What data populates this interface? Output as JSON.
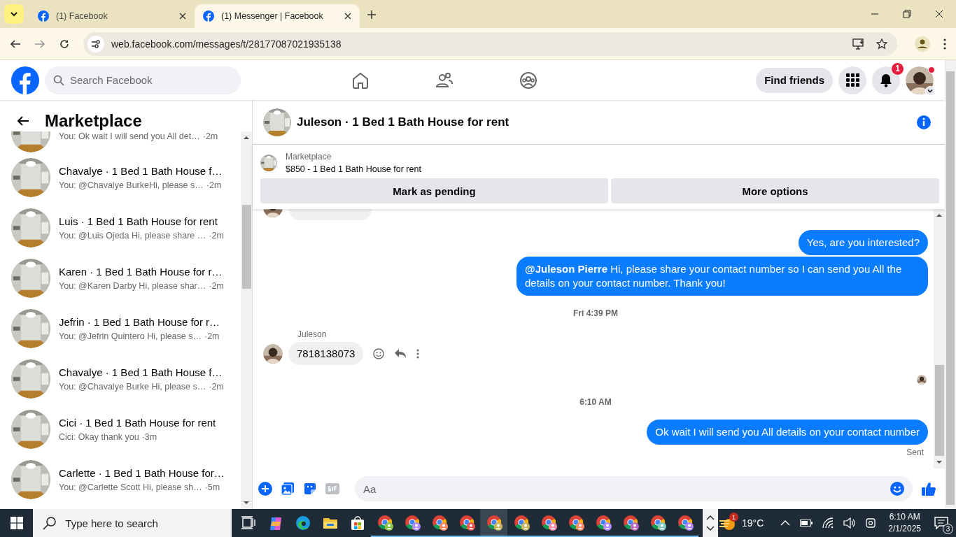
{
  "browser": {
    "tabs": [
      {
        "title": "(1) Facebook",
        "selected": false
      },
      {
        "title": "(1) Messenger | Facebook",
        "selected": true
      }
    ],
    "url": "web.facebook.com/messages/t/28177087021935138"
  },
  "header": {
    "search": {
      "placeholder": "Search Facebook"
    },
    "find_friends": "Find friends",
    "notification_badge": "1"
  },
  "sidebar": {
    "title": "Marketplace",
    "conversations": [
      {
        "preview": "You: Ok wait I will send you All det…",
        "time": "·2m"
      },
      {
        "title": "Chavalye · 1 Bed 1 Bath House f…",
        "preview": "You: @Chavalye BurkeHi, please s…",
        "time": "·2m"
      },
      {
        "title": "Luis · 1 Bed 1 Bath House for rent",
        "preview": "You: @Luis Ojeda Hi, please share …",
        "time": "·2m"
      },
      {
        "title": "Karen · 1 Bed 1 Bath House for r…",
        "preview": "You: @Karen Darby Hi, please shar…",
        "time": "·2m"
      },
      {
        "title": "Jefrin · 1 Bed 1 Bath House for r…",
        "preview": "You: @Jefrin Quintero Hi, please s…",
        "time": "·2m"
      },
      {
        "title": "Chavalye · 1 Bed 1 Bath House f…",
        "preview": "You: @Chavalye Burke Hi, please s…",
        "time": "·2m"
      },
      {
        "title": "Cici · 1 Bed 1 Bath House for rent",
        "preview": "Cici: Okay thank you",
        "time": "·3m"
      },
      {
        "title": "Carlette · 1 Bed 1 Bath House for…",
        "preview": "You: @Carlette Scott Hi, please sh…",
        "time": "·5m"
      }
    ]
  },
  "chat": {
    "title": "Juleson · 1 Bed 1 Bath House for rent",
    "listing": {
      "label": "Marketplace",
      "text": "$850 - 1 Bed 1 Bath House for rent",
      "buttons": [
        "Mark as pending",
        "More options"
      ]
    },
    "messages": [
      {
        "kind": "incoming-cut"
      },
      {
        "kind": "outgoing",
        "text": "Yes, are you interested?"
      },
      {
        "kind": "outgoing",
        "text": "**@Juleson Pierre** Hi, please share your contact number so I can send you All the details on your contact number. Thank you!"
      },
      {
        "kind": "timestamp",
        "text": "Fri 4:39 PM"
      },
      {
        "kind": "incoming",
        "sender": "Juleson",
        "text": "7818138073"
      },
      {
        "kind": "read-receipt"
      },
      {
        "kind": "timestamp",
        "text": "6:10 AM"
      },
      {
        "kind": "outgoing",
        "text": "Ok wait I will send you All details on your contact number",
        "status": "Sent"
      }
    ],
    "composer": {
      "placeholder": "Aa"
    }
  },
  "taskbar": {
    "search": {
      "placeholder": "Type here to search"
    },
    "apps": [
      {
        "kind": "taskview"
      },
      {
        "kind": "copilot"
      },
      {
        "kind": "edge"
      },
      {
        "kind": "explorer"
      },
      {
        "kind": "store"
      },
      {
        "kind": "chrome",
        "color": "#8bc34a",
        "selected": false
      },
      {
        "kind": "chrome",
        "color": "#b388ff",
        "selected": false
      },
      {
        "kind": "chrome",
        "color": "#ff8a65",
        "selected": false
      },
      {
        "kind": "chrome",
        "color": "#ef5350",
        "selected": false
      },
      {
        "kind": "chrome",
        "color": "#c8b560",
        "selected": true
      },
      {
        "kind": "chrome",
        "color": "#c8b560",
        "selected": false
      },
      {
        "kind": "chrome",
        "color": "#f48fb1",
        "selected": false
      },
      {
        "kind": "chrome",
        "color": "#ff8a65",
        "selected": false
      },
      {
        "kind": "chrome",
        "color": "#b388ff",
        "selected": false
      },
      {
        "kind": "chrome",
        "color": "#ba68c8",
        "selected": false
      },
      {
        "kind": "chrome",
        "color": "#80cbc4",
        "selected": false
      },
      {
        "kind": "chrome",
        "color": "#b388ff",
        "selected": false
      }
    ],
    "weather": {
      "badge": "1",
      "temperature": "19°C"
    },
    "time": "6:10 AM",
    "date": "2/1/2025",
    "notifications": "3"
  }
}
